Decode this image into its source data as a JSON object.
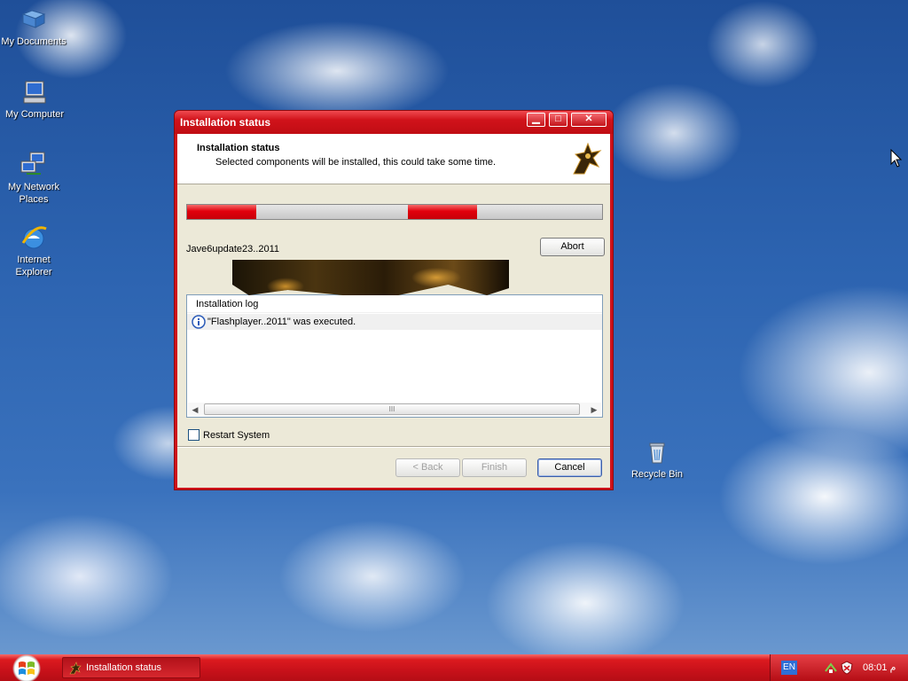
{
  "desktop": {
    "icons": [
      {
        "label": "My Documents"
      },
      {
        "label": "My Computer"
      },
      {
        "label": "My Network Places"
      },
      {
        "label": "Internet Explorer"
      },
      {
        "label": "Recycle Bin"
      }
    ]
  },
  "window": {
    "title": "Installation status",
    "controls": {
      "minimize": "▁",
      "maximize": "□",
      "close": "✕"
    },
    "header": {
      "title": "Installation status",
      "subtitle": "Selected components will be installed, this could take some time."
    },
    "progress": {
      "indeterminate": true,
      "color": "#e1000c"
    },
    "current_item": "Jave6update23..2011",
    "abort_label": "Abort",
    "log": {
      "header": "Installation log",
      "entries": [
        {
          "icon": "info-icon",
          "text": "\"Flashplayer..2011\" was executed."
        }
      ]
    },
    "scrollbar_grip": "III",
    "restart_label": "Restart System",
    "restart_checked": false,
    "buttons": {
      "back": "< Back",
      "finish": "Finish",
      "cancel": "Cancel"
    }
  },
  "taskbar": {
    "task_label": "Installation status",
    "language": "EN",
    "clock": "م 08:01",
    "accent": "#d0121a"
  }
}
